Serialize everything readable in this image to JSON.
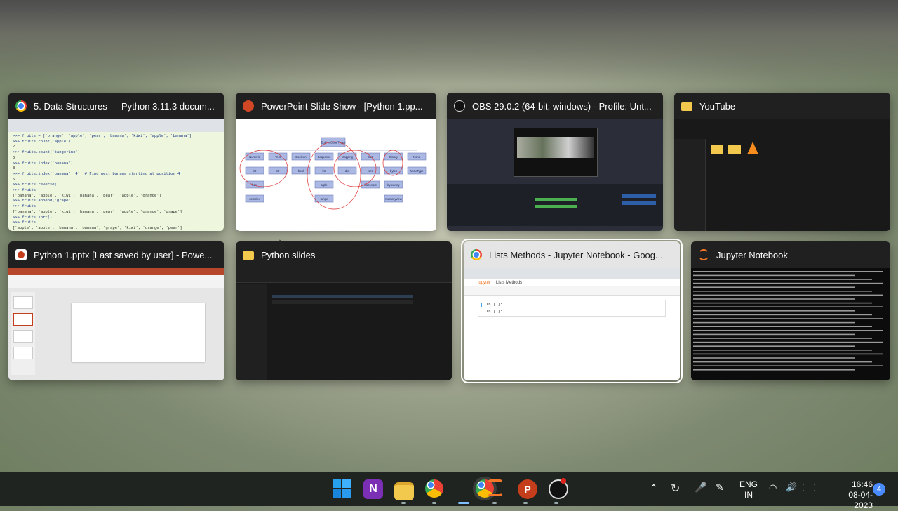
{
  "windows": [
    {
      "title": "5. Data Structures — Python 3.11.3 docum...",
      "icon": "chrome-icon"
    },
    {
      "title": "PowerPoint Slide Show - [Python 1.pp...",
      "icon": "powerpoint-slideshow-icon"
    },
    {
      "title": "OBS 29.0.2 (64-bit, windows) - Profile: Unt...",
      "icon": "obs-icon"
    },
    {
      "title": "YouTube",
      "icon": "folder-icon"
    },
    {
      "title": "Python 1.pptx [Last saved by user] - Powe...",
      "icon": "powerpoint-icon"
    },
    {
      "title": "Python slides",
      "icon": "folder-icon"
    },
    {
      "title": "Lists Methods - Jupyter Notebook - Goog...",
      "icon": "chrome-icon"
    },
    {
      "title": "Jupyter Notebook",
      "icon": "jupyter-icon"
    }
  ],
  "docs_code": [
    ">>> fruits = ['orange', 'apple', 'pear', 'banana', 'kiwi', 'apple', 'banana']",
    ">>> fruits.count('apple')",
    "2",
    ">>> fruits.count('tangerine')",
    "0",
    ">>> fruits.index('banana')",
    "3",
    ">>> fruits.index('banana', 4)  # Find next banana starting at position 4",
    "6",
    ">>> fruits.reverse()",
    ">>> fruits",
    "['banana', 'apple', 'kiwi', 'banana', 'pear', 'apple', 'orange']",
    ">>> fruits.append('grape')",
    ">>> fruits",
    "['banana', 'apple', 'kiwi', 'banana', 'pear', 'apple', 'orange', 'grape']",
    ">>> fruits.sort()",
    ">>> fruits",
    "['apple', 'apple', 'banana', 'banana', 'grape', 'kiwi', 'orange', 'pear']",
    ">>> fruits.pop()",
    "'pear'"
  ],
  "slide": {
    "root": "Built in Data Types",
    "row1": [
      "Numeric",
      "Text",
      "Boolean",
      "Sequence",
      "Mapping",
      "Set",
      "Binary",
      "None"
    ],
    "row2": [
      "int",
      "str",
      "bool",
      "list",
      "dict",
      "set",
      "bytes",
      "NoneType"
    ],
    "row3": [
      "float",
      "",
      "",
      "tuple",
      "",
      "frozenset",
      "bytearray",
      ""
    ],
    "row4": [
      "complex",
      "",
      "",
      "range",
      "",
      "",
      "memoryview",
      ""
    ]
  },
  "jupyter": {
    "title": "Lists Methods",
    "cells": [
      "In [ ]:",
      "In [ ]:"
    ]
  },
  "taskbar": {
    "lang_top": "ENG",
    "lang_bottom": "IN",
    "time": "16:46",
    "date": "08-04-2023",
    "notifications": "4"
  },
  "colors": {
    "taskbar": "#1f2421",
    "accent": "#ffffff",
    "chrome_red": "#ea4335",
    "ppt": "#c43e1c",
    "folder": "#f2c94c"
  }
}
